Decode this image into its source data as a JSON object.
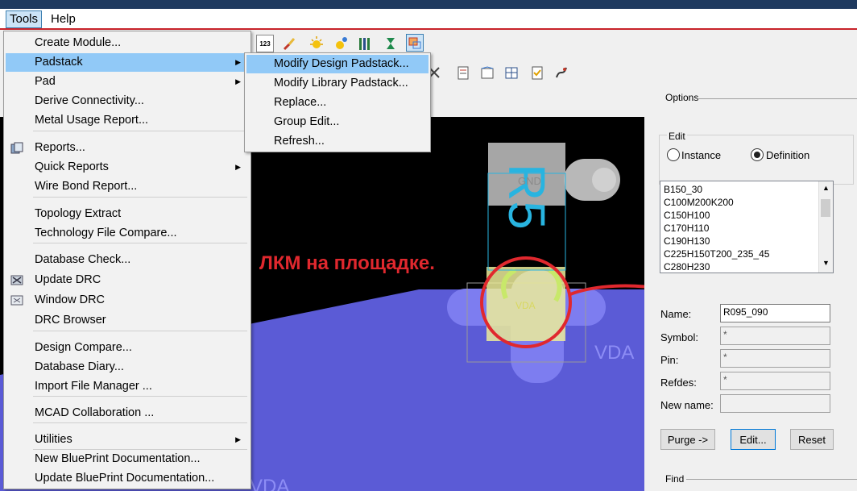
{
  "menubar": {
    "tools": "Tools",
    "help": "Help"
  },
  "tools_menu": {
    "items": [
      {
        "label": "Create Module..."
      },
      {
        "label": "Padstack",
        "submenu": true
      },
      {
        "label": "Pad",
        "submenu": true
      },
      {
        "label": "Derive Connectivity..."
      },
      {
        "label": "Metal Usage Report..."
      },
      {
        "label": "Reports..."
      },
      {
        "label": "Quick Reports",
        "submenu": true
      },
      {
        "label": "Wire Bond Report..."
      },
      {
        "label": "Topology Extract"
      },
      {
        "label": "Technology File Compare..."
      },
      {
        "label": "Database Check..."
      },
      {
        "label": "Update DRC"
      },
      {
        "label": "Window DRC"
      },
      {
        "label": "DRC Browser"
      },
      {
        "label": "Design Compare..."
      },
      {
        "label": "Database Diary..."
      },
      {
        "label": "Import File Manager ..."
      },
      {
        "label": "MCAD Collaboration ..."
      },
      {
        "label": "Utilities",
        "submenu": true
      },
      {
        "label": "New BluePrint Documentation..."
      },
      {
        "label": "Update BluePrint Documentation..."
      }
    ]
  },
  "padstack_submenu": {
    "items": [
      {
        "label": "Modify Design Padstack..."
      },
      {
        "label": "Modify Library Padstack..."
      },
      {
        "label": "Replace..."
      },
      {
        "label": "Group Edit..."
      },
      {
        "label": "Refresh..."
      }
    ]
  },
  "toolbar": {
    "counter_label": "123"
  },
  "options": {
    "title": "Options",
    "edit_group": "Edit",
    "instance_label": "Instance",
    "definition_label": "Definition",
    "padstacks": [
      "B150_30",
      "C100M200K200",
      "C150H100",
      "C170H110",
      "C190H130",
      "C225H150T200_235_45",
      "C280H230"
    ],
    "name_label": "Name:",
    "name_value": "R095_090",
    "symbol_label": "Symbol:",
    "symbol_value": "*",
    "pin_label": "Pin:",
    "pin_value": "*",
    "refdes_label": "Refdes:",
    "refdes_value": "*",
    "newname_label": "New name:",
    "newname_value": "",
    "purge_button": "Purge ->",
    "edit_button": "Edit...",
    "reset_button": "Reset"
  },
  "find": {
    "title": "Find"
  },
  "canvas": {
    "gnd_label": "GND",
    "vda_label": "VDA",
    "vda_net_label": "VDA",
    "vda_bottom_label": "VDA",
    "refdes_text": "R5",
    "refdes_text2": "5",
    "annotation": "ЛКМ на площадке."
  },
  "colors": {
    "accent_red": "#e0282e",
    "plane_blue": "#5b5bd6",
    "highlight_yellow": "#ecec9a",
    "pin_cyan": "#28b4e0"
  }
}
